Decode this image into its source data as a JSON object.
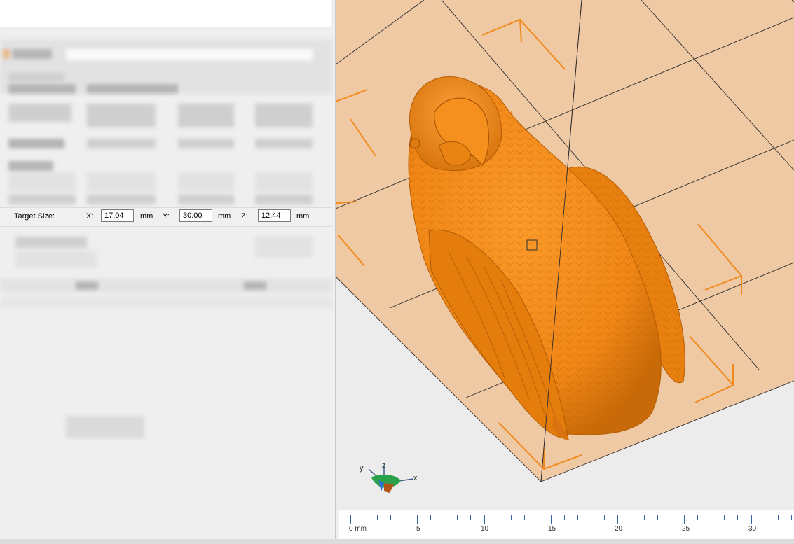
{
  "target_size": {
    "label": "Target Size:",
    "x_label": "X:",
    "x_value": "17.04",
    "x_unit": "mm",
    "y_label": "Y:",
    "y_value": "30.00",
    "y_unit": "mm",
    "z_label": "Z:",
    "z_value": "12.44",
    "z_unit": "mm"
  },
  "axis_gizmo": {
    "x": "x",
    "y": "y",
    "z": "z"
  },
  "ruler": {
    "labels": [
      "0 mm",
      "5",
      "10",
      "15",
      "20",
      "25",
      "30"
    ]
  },
  "colors": {
    "model": "#f08a1c",
    "bed": "#efc9a3",
    "bracket": "#f08a1c",
    "ruler_tick": "#3c63a8"
  }
}
